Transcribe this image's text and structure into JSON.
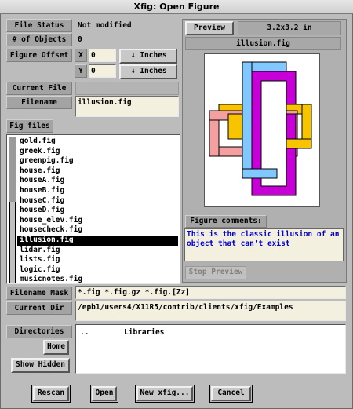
{
  "window": {
    "title": "Xfig: Open Figure"
  },
  "info": {
    "file_status_label": "File Status",
    "file_status_value": "Not modified",
    "objects_label": "# of Objects",
    "objects_value": "0",
    "offset_label": "Figure Offset",
    "x_label": "X",
    "x_value": "0",
    "y_label": "Y",
    "y_value": "0",
    "units_x": "Inches",
    "units_y": "Inches"
  },
  "current_file": {
    "label": "Current File",
    "filename_label": "Filename",
    "filename_value": "illusion.fig"
  },
  "files": {
    "tab_label": "Fig files",
    "items": [
      "gold.fig",
      "greek.fig",
      "greenpig.fig",
      "house.fig",
      "houseA.fig",
      "houseB.fig",
      "houseC.fig",
      "houseD.fig",
      "house_elev.fig",
      "housecheck.fig",
      "illusion.fig",
      "lidar.fig",
      "lists.fig",
      "logic.fig",
      "musicnotes.fig"
    ],
    "selected": "illusion.fig"
  },
  "preview": {
    "label": "Preview",
    "size": "3.2x3.2 in",
    "filename": "illusion.fig",
    "comments_label": "Figure comments:",
    "comments": "This is the classic illusion of an object that can't exist",
    "stop_label": "Stop Preview",
    "colors": {
      "yellow": "#f8c400",
      "pink": "#f4a0a0",
      "blue": "#80c8ff",
      "magenta": "#c800d8"
    }
  },
  "mask": {
    "label": "Filename Mask",
    "value": "*.fig *.fig.gz *.fig.[Zz]"
  },
  "dir": {
    "label": "Current Dir",
    "value": "/epb1/users4/X11R5/contrib/clients/xfig/Examples"
  },
  "directories": {
    "label": "Directories",
    "home_label": "Home",
    "show_hidden_label": "Show Hidden",
    "entries": [
      "..",
      "Libraries"
    ]
  },
  "buttons": {
    "rescan": "Rescan",
    "open": "Open",
    "new": "New xfig...",
    "cancel": "Cancel"
  }
}
